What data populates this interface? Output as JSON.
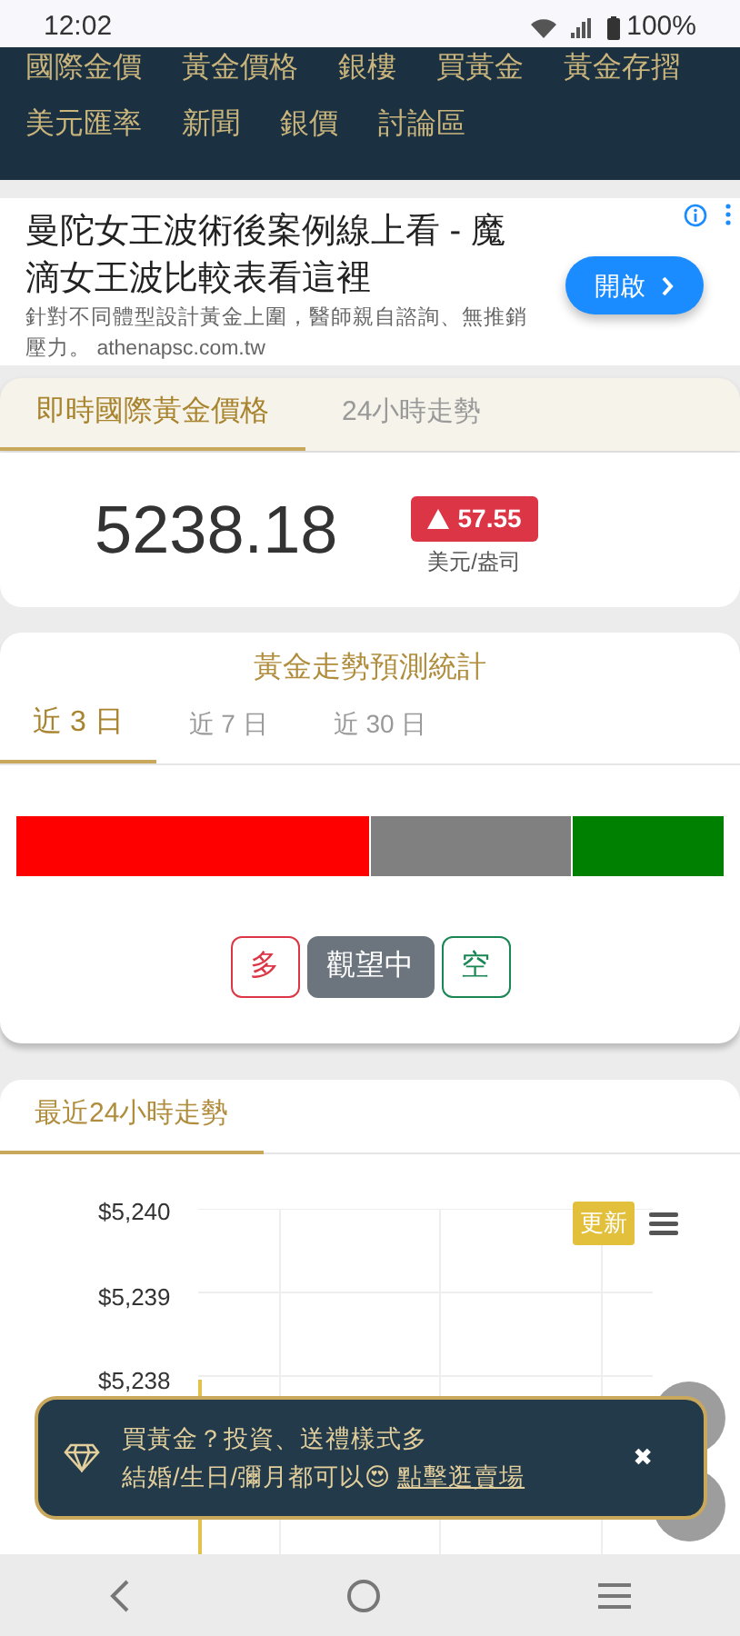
{
  "status_bar": {
    "time": "12:02",
    "battery": "100%"
  },
  "nav": {
    "rows": [
      [
        "國際金價",
        "黃金價格",
        "銀樓",
        "買黃金",
        "黃金存摺"
      ],
      [
        "美元匯率",
        "新聞",
        "銀價",
        "討論區"
      ]
    ]
  },
  "ad": {
    "title": "曼陀女王波術後案例線上看 - 魔滴女王波比較表看這裡",
    "description": "針對不同體型設計黃金上圍，醫師親自諮詢、無推銷壓力。 athenapsc.com.tw",
    "button": "開啟"
  },
  "price_tabs": [
    {
      "label": "即時國際黃金價格",
      "selected": true
    },
    {
      "label": "24小時走勢",
      "selected": false
    }
  ],
  "price": {
    "value": "5238.18",
    "change": "57.55",
    "unit": "美元/盎司"
  },
  "forecast": {
    "title": "黃金走勢預測統計",
    "tabs": [
      {
        "label": "近 3 日",
        "selected": true
      },
      {
        "label": "近 7 日",
        "selected": false
      },
      {
        "label": "近 30 日",
        "selected": false
      }
    ],
    "segments": [
      {
        "color": "#ff0000"
      },
      {
        "color": "#808080"
      },
      {
        "color": "#008000"
      }
    ],
    "buttons": [
      {
        "label": "多",
        "kind": "long",
        "selected": false
      },
      {
        "label": "觀望中",
        "kind": "neutral",
        "selected": true
      },
      {
        "label": "空",
        "kind": "short",
        "selected": false
      }
    ]
  },
  "trend": {
    "title": "最近24小時走勢",
    "refresh": "更新",
    "y_ticks": [
      "$5,240",
      "$5,239",
      "$5,238"
    ]
  },
  "toast": {
    "line_1": "買黃金？投資、送禮樣式多",
    "line_2": "結婚/生日/彌月都可以😍",
    "link": "點擊逛賣場",
    "close": "✖"
  }
}
